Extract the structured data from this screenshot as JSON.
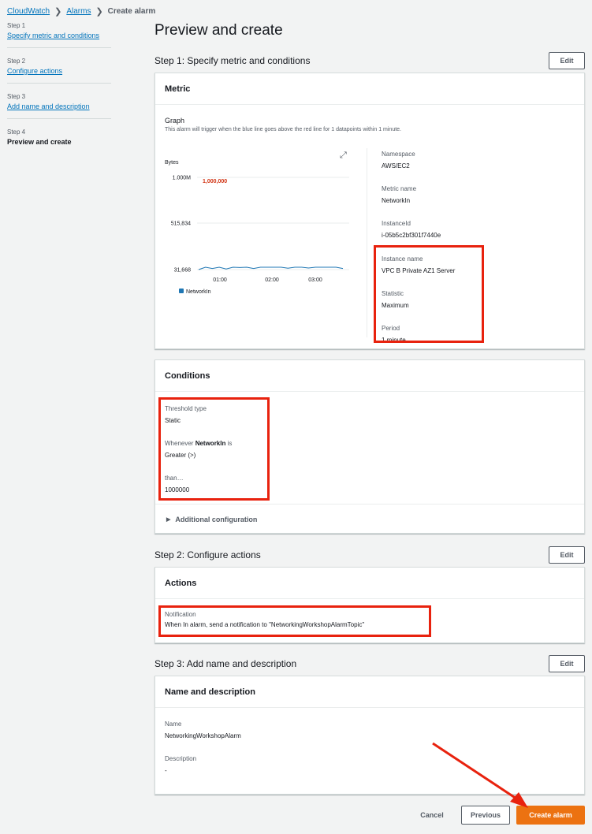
{
  "breadcrumb": {
    "root": "CloudWatch",
    "parent": "Alarms",
    "current": "Create alarm"
  },
  "sidebar": {
    "steps": [
      {
        "num": "Step 1",
        "label": "Specify metric and conditions"
      },
      {
        "num": "Step 2",
        "label": "Configure actions"
      },
      {
        "num": "Step 3",
        "label": "Add name and description"
      },
      {
        "num": "Step 4",
        "label": "Preview and create"
      }
    ]
  },
  "page": {
    "title": "Preview and create"
  },
  "step1": {
    "heading": "Step 1: Specify metric and conditions",
    "edit": "Edit",
    "metric_panel": {
      "title": "Metric",
      "graph_label": "Graph",
      "graph_desc": "This alarm will trigger when the blue line goes above the red line for 1 datapoints within 1 minute.",
      "expand_icon": "expand-icon"
    },
    "details": {
      "namespace_label": "Namespace",
      "namespace": "AWS/EC2",
      "metric_name_label": "Metric name",
      "metric_name": "NetworkIn",
      "instance_id_label": "InstanceId",
      "instance_id": "i-05b5c2bf301f7440e",
      "instance_name_label": "Instance name",
      "instance_name": "VPC B Private AZ1 Server",
      "statistic_label": "Statistic",
      "statistic": "Maximum",
      "period_label": "Period",
      "period": "1 minute"
    },
    "conditions": {
      "title": "Conditions",
      "threshold_type_label": "Threshold type",
      "threshold_type": "Static",
      "whenever_prefix": "Whenever ",
      "whenever_metric": "NetworkIn",
      "whenever_suffix": " is",
      "operator": "Greater (>)",
      "than_label": "than…",
      "than_value": "1000000",
      "additional": "Additional configuration"
    }
  },
  "step2": {
    "heading": "Step 2: Configure actions",
    "edit": "Edit",
    "actions_title": "Actions",
    "notification_label": "Notification",
    "notification_value": "When In alarm, send a notification to \"NetworkingWorkshopAlarmTopic\""
  },
  "step3": {
    "heading": "Step 3: Add name and description",
    "edit": "Edit",
    "panel_title": "Name and description",
    "name_label": "Name",
    "name_value": "NetworkingWorkshopAlarm",
    "description_label": "Description",
    "description_value": "-"
  },
  "footer": {
    "cancel": "Cancel",
    "previous": "Previous",
    "create": "Create alarm"
  },
  "chart_data": {
    "type": "line",
    "ylabel": "Bytes",
    "y_ticks": [
      "1.000M",
      "515,834",
      "31,668"
    ],
    "x_ticks": [
      "01:00",
      "02:00",
      "03:00"
    ],
    "threshold_label": "1,000,000",
    "threshold": 1000000,
    "ylim": [
      31668,
      1000000
    ],
    "series": [
      {
        "name": "NetworkIn",
        "color": "#1f77b4",
        "values": [
          31668,
          32500,
          31900,
          33200,
          31800,
          32800,
          32100,
          33600,
          31900,
          32400,
          33000,
          32200,
          32900,
          31950,
          32600,
          33300,
          32000,
          32700,
          32300,
          33100,
          32500,
          31900
        ]
      }
    ],
    "threshold_color": "#d13212"
  },
  "colors": {
    "accent": "#ec7211",
    "link": "#0073bb",
    "highlight": "#e8220e"
  }
}
